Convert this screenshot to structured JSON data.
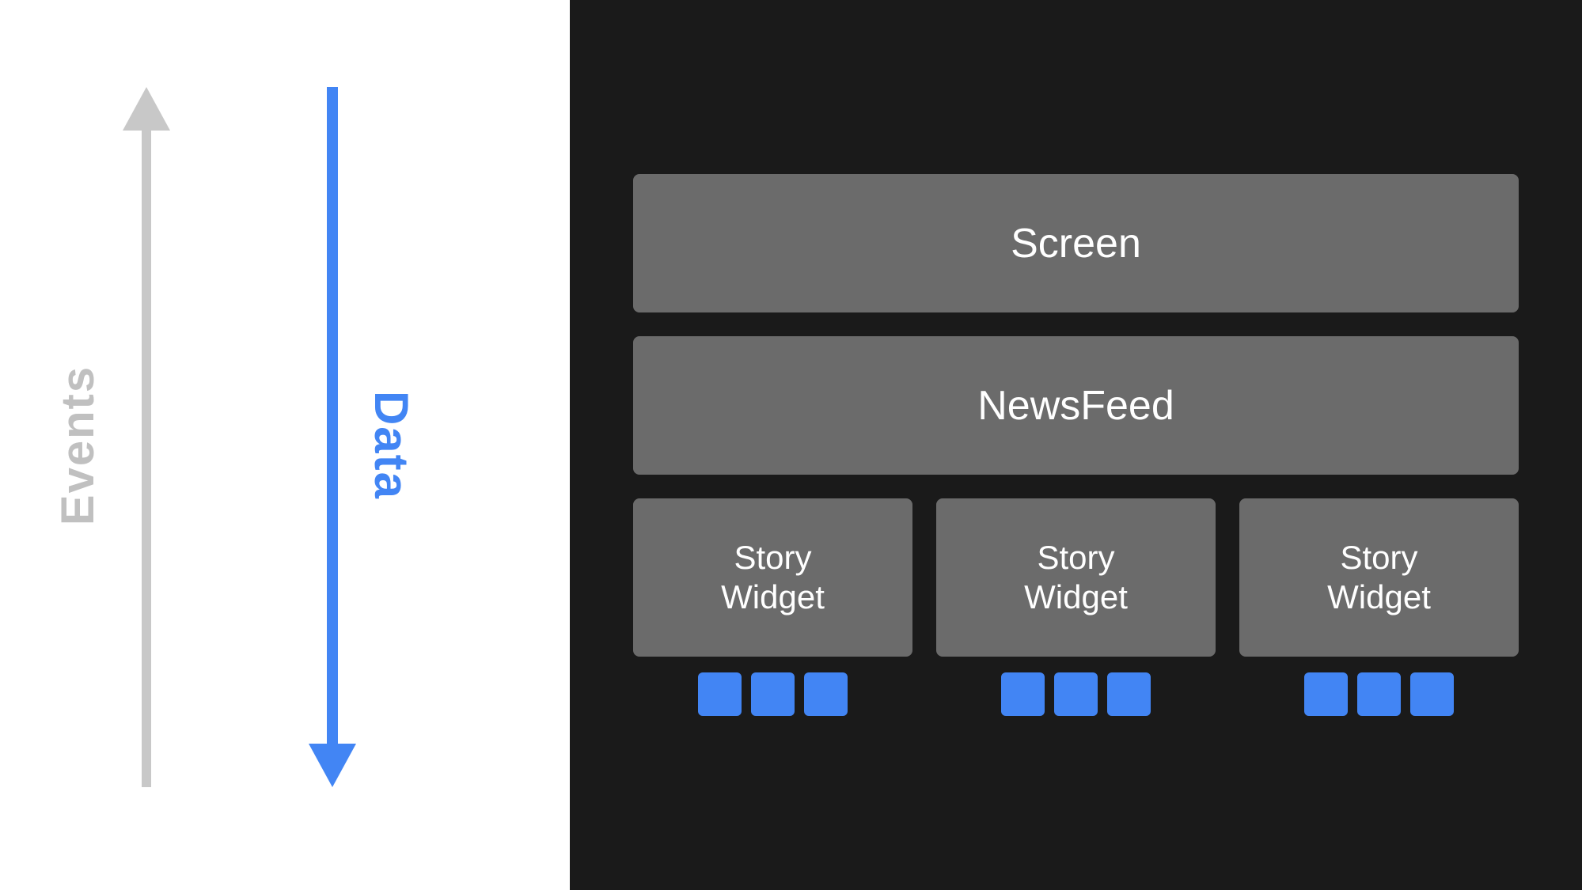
{
  "left_panel": {
    "background": "#ffffff",
    "events_label": "Events",
    "data_label": "Data",
    "events_color": "#c0c0c0",
    "data_color": "#4285f4",
    "arrow_up_color": "#c8c8c8",
    "arrow_down_color": "#4285f4"
  },
  "right_panel": {
    "background": "#1a1a1a",
    "screen": {
      "label": "Screen"
    },
    "newsfeed": {
      "label": "NewsFeed"
    },
    "story_widgets": [
      {
        "label": "Story\nWidget",
        "dots": 3
      },
      {
        "label": "Story\nWidget",
        "dots": 3
      },
      {
        "label": "Story\nWidget",
        "dots": 3
      }
    ]
  }
}
